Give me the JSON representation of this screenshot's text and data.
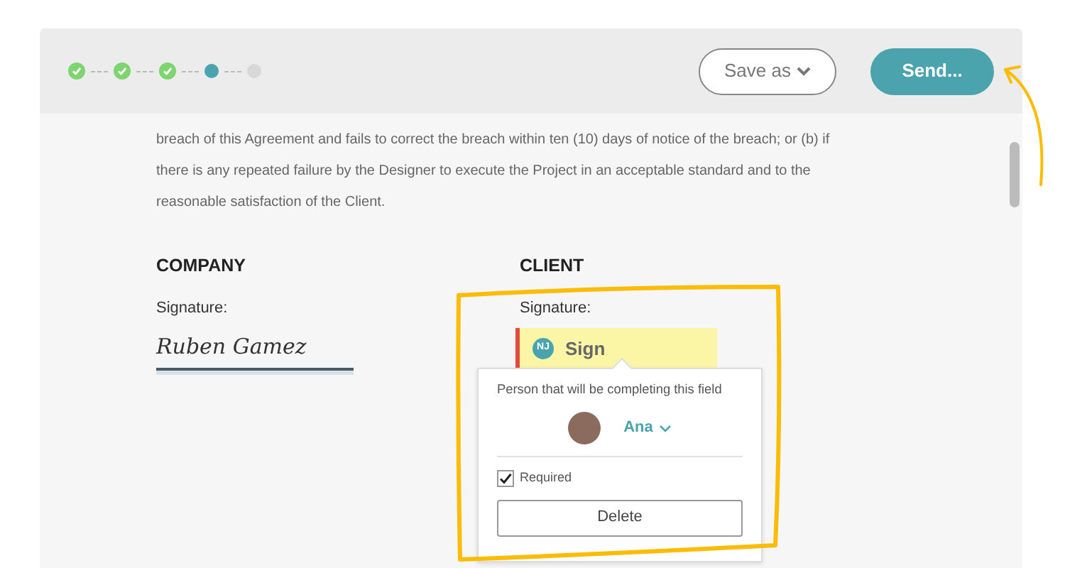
{
  "steps": [
    {
      "done": true,
      "current": false
    },
    {
      "done": true,
      "current": false
    },
    {
      "done": true,
      "current": false
    },
    {
      "done": false,
      "current": true
    },
    {
      "done": false,
      "current": false
    }
  ],
  "toolbar": {
    "save_as": "Save as",
    "send": "Send..."
  },
  "document": {
    "paragraph_lines": [
      "breach of this Agreement and fails to correct the breach within ten (10) days of notice of the breach; or (b) if",
      "there is any repeated failure by the Designer to execute the Project in an acceptable standard and to the",
      "reasonable satisfaction of the Client."
    ],
    "parties": [
      {
        "heading": "COMPANY",
        "label": "Signature:",
        "kind": "signed",
        "signature": "Ruben Gamez"
      },
      {
        "heading": "CLIENT",
        "label": "Signature:",
        "kind": "field",
        "initials": "NJ",
        "field_label": "Sign",
        "required": true
      }
    ]
  },
  "popover": {
    "prompt": "Person that will be completing this field",
    "assignee": "Ana",
    "required_label": "Required",
    "required": true,
    "delete": "Delete"
  }
}
